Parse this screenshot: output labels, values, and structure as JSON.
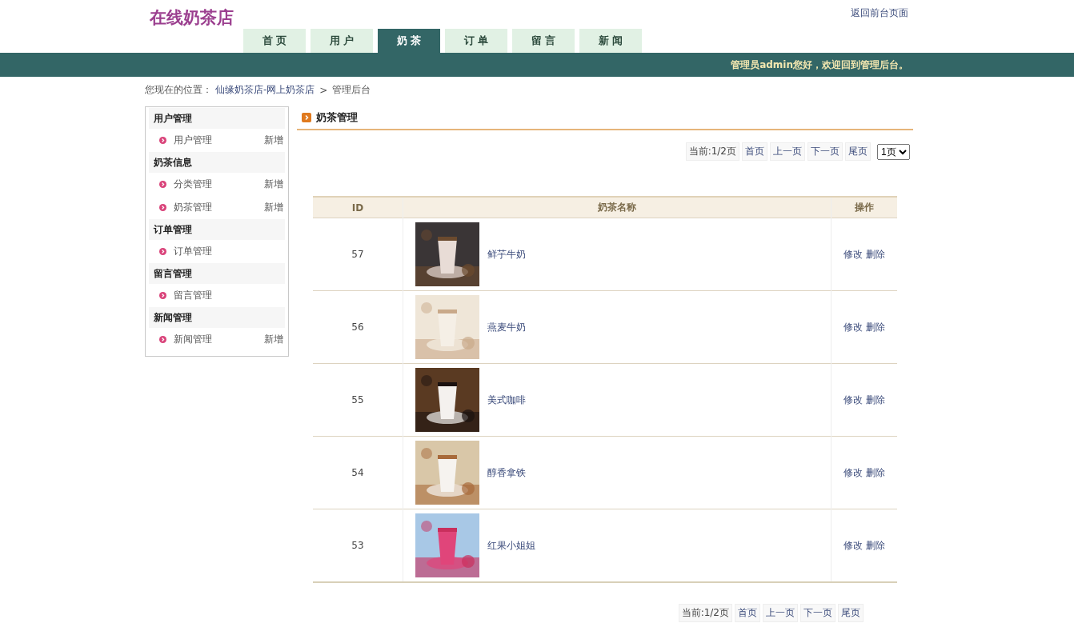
{
  "header": {
    "logo": "在线奶茶店",
    "back_link": "返回前台页面"
  },
  "tabs": [
    {
      "label": "首 页",
      "selected": false
    },
    {
      "label": "用 户",
      "selected": false
    },
    {
      "label": "奶 茶",
      "selected": true
    },
    {
      "label": "订 单",
      "selected": false
    },
    {
      "label": "留 言",
      "selected": false
    },
    {
      "label": "新 闻",
      "selected": false
    }
  ],
  "welcome": "管理员admin您好，欢迎回到管理后台。",
  "breadcrumb": {
    "prefix": "您现在的位置：",
    "link": "仙缘奶茶店-网上奶茶店",
    "separator": ">",
    "current": "管理后台"
  },
  "sidebar": [
    {
      "title": "用户管理",
      "items": [
        {
          "label": "用户管理",
          "add": "新增"
        }
      ]
    },
    {
      "title": "奶茶信息",
      "items": [
        {
          "label": "分类管理",
          "add": "新增"
        },
        {
          "label": "奶茶管理",
          "add": "新增"
        }
      ]
    },
    {
      "title": "订单管理",
      "items": [
        {
          "label": "订单管理"
        }
      ]
    },
    {
      "title": "留言管理",
      "items": [
        {
          "label": "留言管理"
        }
      ]
    },
    {
      "title": "新闻管理",
      "items": [
        {
          "label": "新闻管理",
          "add": "新增"
        }
      ]
    }
  ],
  "panel_title": "奶茶管理",
  "pager_top": {
    "status": "当前:1/2页",
    "links": [
      "首页",
      "上一页",
      "下一页",
      "尾页"
    ],
    "select": "1页"
  },
  "table": {
    "columns": [
      "ID",
      "奶茶名称",
      "操作"
    ],
    "rows": [
      {
        "id": "57",
        "name": "鲜芋牛奶",
        "actions": [
          "修改",
          "删除"
        ]
      },
      {
        "id": "56",
        "name": "燕麦牛奶",
        "actions": [
          "修改",
          "删除"
        ]
      },
      {
        "id": "55",
        "name": "美式咖啡",
        "actions": [
          "修改",
          "删除"
        ]
      },
      {
        "id": "54",
        "name": "醇香拿铁",
        "actions": [
          "修改",
          "删除"
        ]
      },
      {
        "id": "53",
        "name": "红果小姐姐",
        "actions": [
          "修改",
          "删除"
        ]
      }
    ]
  },
  "pager_bottom": {
    "status": "当前:1/2页",
    "links": [
      "首页",
      "上一页",
      "下一页",
      "尾页"
    ]
  }
}
